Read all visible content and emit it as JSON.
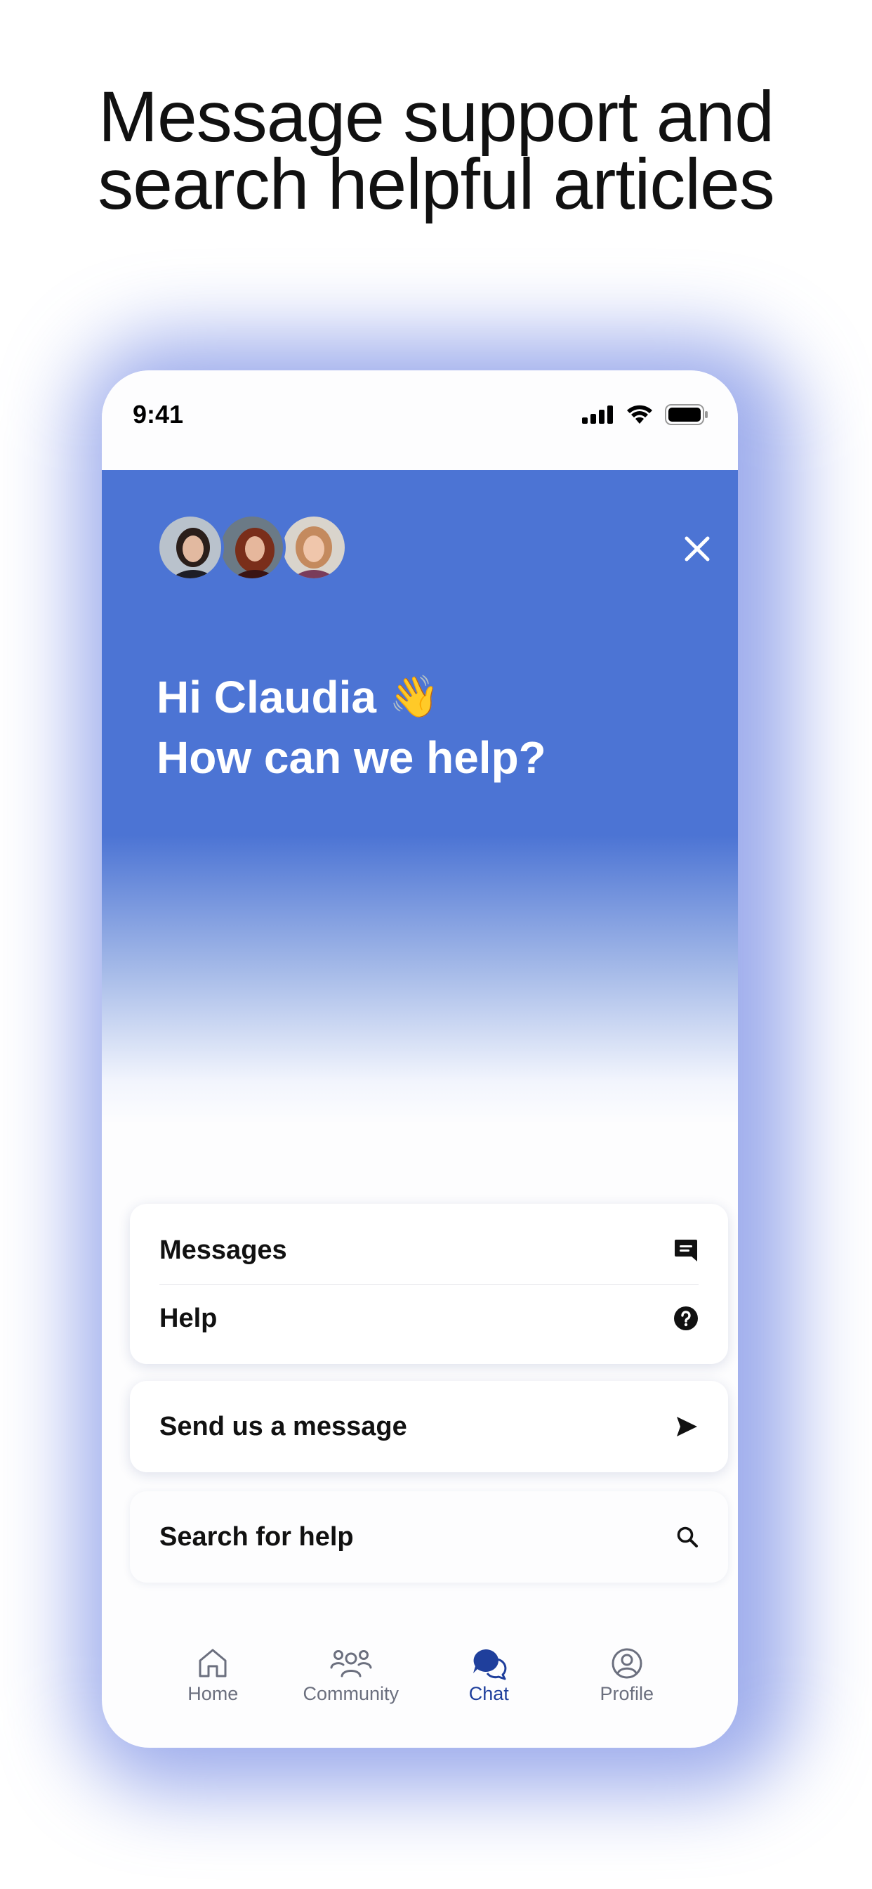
{
  "promo": {
    "headline_line1": "Message support and",
    "headline_line2": "search helpful articles"
  },
  "status_bar": {
    "time": "9:41"
  },
  "header": {
    "greeting_line1": "Hi Claudia",
    "greeting_emoji": "👋",
    "greeting_line2": "How can we help?",
    "avatars": [
      "support-agent-1",
      "support-agent-2",
      "support-agent-3"
    ]
  },
  "menu": {
    "items": [
      {
        "label": "Messages",
        "icon": "message-icon"
      },
      {
        "label": "Help",
        "icon": "question-circle-icon"
      }
    ]
  },
  "send_message": {
    "label": "Send us a message",
    "icon": "send-arrow-icon"
  },
  "search_help": {
    "label": "Search for help",
    "icon": "search-icon"
  },
  "tabbar": {
    "tabs": [
      {
        "label": "Home",
        "icon": "home-icon",
        "active": false
      },
      {
        "label": "Community",
        "icon": "community-icon",
        "active": false
      },
      {
        "label": "Chat",
        "icon": "chat-icon",
        "active": true
      },
      {
        "label": "Profile",
        "icon": "profile-icon",
        "active": false
      }
    ]
  },
  "colors": {
    "brand_blue": "#4c74d4",
    "active_tab": "#1f3f9c",
    "inactive_tab": "#6b6f7e"
  }
}
